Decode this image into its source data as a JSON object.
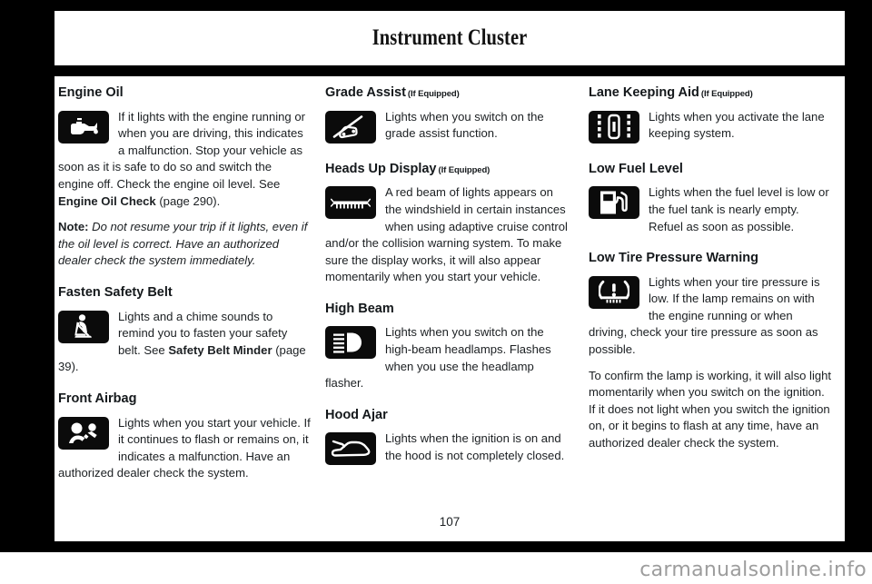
{
  "header": {
    "title": "Instrument Cluster"
  },
  "footer": {
    "page_number": "107",
    "watermark": "carmanualsonline.info"
  },
  "columns": [
    {
      "id": "column-left",
      "sections": [
        {
          "id": "engine-oil",
          "title": "Engine Oil",
          "equipped": "",
          "icon": "engine-oil-can-icon",
          "paragraphs": [
            {
              "id": "engine-oil-main",
              "runs": [
                {
                  "text": "If it lights with the engine running or when you are driving, this indicates a malfunction. Stop your vehicle as soon as it is safe to do so and switch the engine off. Check the engine oil level.  See ",
                  "style": "normal"
                },
                {
                  "text": "Engine Oil Check",
                  "style": "bold"
                },
                {
                  "text": " (page 290).",
                  "style": "normal"
                }
              ]
            },
            {
              "id": "engine-oil-note",
              "runs": [
                {
                  "text": "Note:",
                  "style": "bold"
                },
                {
                  "text": " ",
                  "style": "normal"
                },
                {
                  "text": "Do not resume your trip if it lights, even if the oil level is correct. Have an authorized dealer check the system immediately.",
                  "style": "italic"
                }
              ]
            }
          ]
        },
        {
          "id": "fasten-safety-belt",
          "title": "Fasten Safety Belt",
          "equipped": "",
          "icon": "seat-belt-icon",
          "paragraphs": [
            {
              "id": "fasten-safety-belt-main",
              "runs": [
                {
                  "text": "Lights and a chime sounds to remind you to fasten your safety belt. See ",
                  "style": "normal"
                },
                {
                  "text": "Safety Belt Minder",
                  "style": "bold"
                },
                {
                  "text": " (page 39).",
                  "style": "normal"
                }
              ]
            }
          ]
        },
        {
          "id": "front-airbag",
          "title": "Front Airbag",
          "equipped": "",
          "icon": "front-airbag-icon",
          "paragraphs": [
            {
              "id": "front-airbag-main",
              "runs": [
                {
                  "text": "Lights when you start your vehicle. If it continues to flash or remains on, it indicates a malfunction. Have an authorized dealer check the system.",
                  "style": "normal"
                }
              ]
            }
          ]
        }
      ]
    },
    {
      "id": "column-middle",
      "sections": [
        {
          "id": "grade-assist",
          "title": "Grade Assist",
          "equipped": "(If Equipped)",
          "icon": "grade-assist-icon",
          "paragraphs": [
            {
              "id": "grade-assist-main",
              "runs": [
                {
                  "text": "Lights when you switch on the grade assist function.",
                  "style": "normal"
                }
              ]
            }
          ]
        },
        {
          "id": "heads-up-display",
          "title": "Heads Up Display",
          "equipped": "(If Equipped)",
          "icon": "heads-up-display-icon",
          "paragraphs": [
            {
              "id": "heads-up-display-main",
              "runs": [
                {
                  "text": "A red beam of lights appears on the windshield in certain instances when using adaptive cruise control and/or the collision warning system. To make sure the display works, it will also appear momentarily when you start your vehicle.",
                  "style": "normal"
                }
              ]
            }
          ]
        },
        {
          "id": "high-beam",
          "title": "High Beam",
          "equipped": "",
          "icon": "high-beam-icon",
          "paragraphs": [
            {
              "id": "high-beam-main",
              "runs": [
                {
                  "text": "Lights when you switch on the high-beam headlamps. Flashes when you use the headlamp flasher.",
                  "style": "normal"
                }
              ]
            }
          ]
        },
        {
          "id": "hood-ajar",
          "title": "Hood Ajar",
          "equipped": "",
          "icon": "hood-ajar-icon",
          "paragraphs": [
            {
              "id": "hood-ajar-main",
              "runs": [
                {
                  "text": "Lights when the ignition is on and the hood is not completely closed.",
                  "style": "normal"
                }
              ]
            }
          ]
        }
      ]
    },
    {
      "id": "column-right",
      "sections": [
        {
          "id": "lane-keeping-aid",
          "title": "Lane Keeping Aid",
          "equipped": "(If Equipped)",
          "icon": "lane-keeping-aid-icon",
          "paragraphs": [
            {
              "id": "lane-keeping-aid-main",
              "runs": [
                {
                  "text": "Lights when you activate the lane keeping system.",
                  "style": "normal"
                }
              ]
            }
          ]
        },
        {
          "id": "low-fuel-level",
          "title": "Low Fuel Level",
          "equipped": "",
          "icon": "fuel-pump-icon",
          "paragraphs": [
            {
              "id": "low-fuel-level-main",
              "runs": [
                {
                  "text": "Lights when the fuel level is low or the fuel tank is nearly empty. Refuel as soon as possible.",
                  "style": "normal"
                }
              ]
            }
          ]
        },
        {
          "id": "low-tire-pressure-warning",
          "title": "Low Tire Pressure Warning",
          "equipped": "",
          "icon": "tire-pressure-icon",
          "paragraphs": [
            {
              "id": "low-tire-pressure-main",
              "runs": [
                {
                  "text": "Lights when your tire pressure is low. If the lamp remains on with the engine running or when driving, check your tire pressure as soon as possible.",
                  "style": "normal"
                }
              ]
            },
            {
              "id": "low-tire-pressure-confirm",
              "runs": [
                {
                  "text": "To confirm the lamp is working, it will also light momentarily when you switch on the ignition. If it does not light when you switch the ignition on, or it begins to flash at any time, have an authorized dealer check the system.",
                  "style": "normal"
                }
              ]
            }
          ]
        }
      ]
    }
  ]
}
